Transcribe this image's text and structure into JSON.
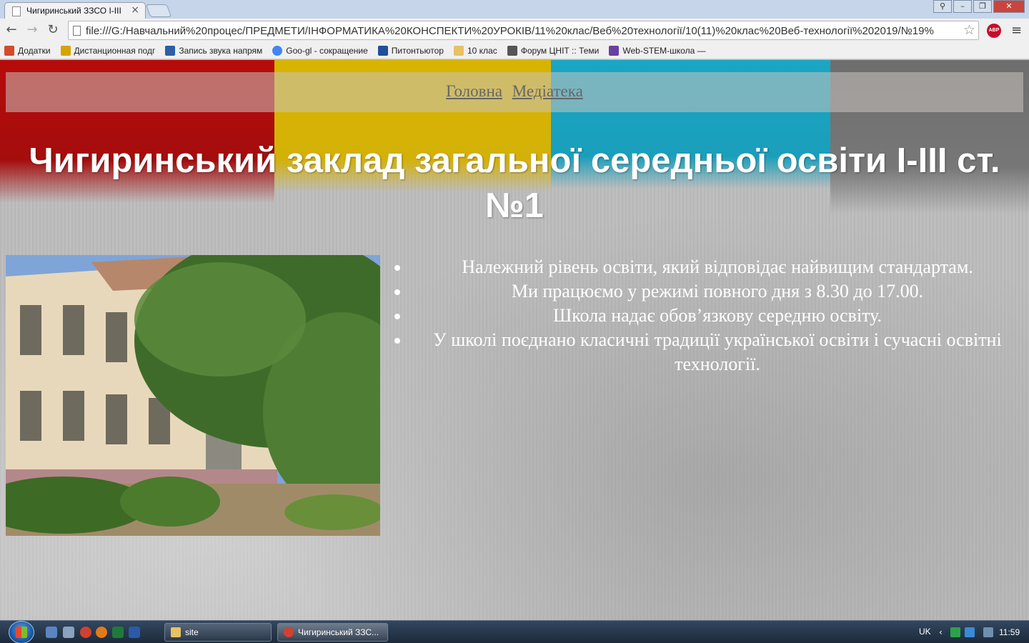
{
  "browser": {
    "tab_title": "Чигиринський ЗЗСО І-ІІІ",
    "tab_close": "×",
    "url": "file:///G:/Навчальний%20процес/ПРЕДМЕТИ/ІНФОРМАТИКА%20КОНСПЕКТИ%20УРОКІВ/11%20клас/Веб%20технології/10(11)%20клас%20Веб-технології%202019/№19%",
    "abp_label": "ABP",
    "window_controls": [
      "⚲",
      "–",
      "❐",
      "✕"
    ],
    "bookmarks": [
      {
        "label": "Додатки",
        "icon": "apps-grid-icon",
        "color": "#d44a2a"
      },
      {
        "label": "Дистанционная подг",
        "icon": "site-favicon",
        "color": "#d6a400"
      },
      {
        "label": "Запись звука напрям",
        "icon": "site-favicon",
        "color": "#2c5fa8"
      },
      {
        "label": "Goo-gl - сокращение",
        "icon": "google-icon",
        "color": "#4285f4"
      },
      {
        "label": "Питонтьютор",
        "icon": "site-favicon",
        "color": "#1f4f9c"
      },
      {
        "label": "10 клас",
        "icon": "folder-icon",
        "color": "#e8c165"
      },
      {
        "label": "Форум ЦНІТ :: Теми",
        "icon": "site-favicon",
        "color": "#555555"
      },
      {
        "label": "Web-STEM-школа —",
        "icon": "site-favicon",
        "color": "#6a3fa0"
      }
    ]
  },
  "page": {
    "nav": [
      {
        "label": "Головна"
      },
      {
        "label": "Медіатека"
      }
    ],
    "title": "Чигиринський заклад загальної середньої освіти І-ІІІ ст. №1",
    "features": [
      "Належний рівень освіти, який відповідає найвищим стандартам.",
      "Ми працюємо у режимі повного дня з 8.30 до 17.00.",
      "Школа надає обов’язкову середню освіту.",
      "У школі поєднано класичні традиції української освіти і сучасні освітні технології."
    ],
    "colors": {
      "stripe_red": "#b70b0b",
      "stripe_yellow": "#d8b400",
      "stripe_cyan": "#1aa6c4",
      "stripe_gray": "#6e6e6e",
      "nav_link": "#666666"
    }
  },
  "taskbar": {
    "tasks": [
      {
        "label": "site",
        "icon": "folder-icon"
      },
      {
        "label": "Чигиринський ЗЗС...",
        "icon": "chrome-icon"
      }
    ],
    "language": "UK",
    "clock": "11:59"
  }
}
